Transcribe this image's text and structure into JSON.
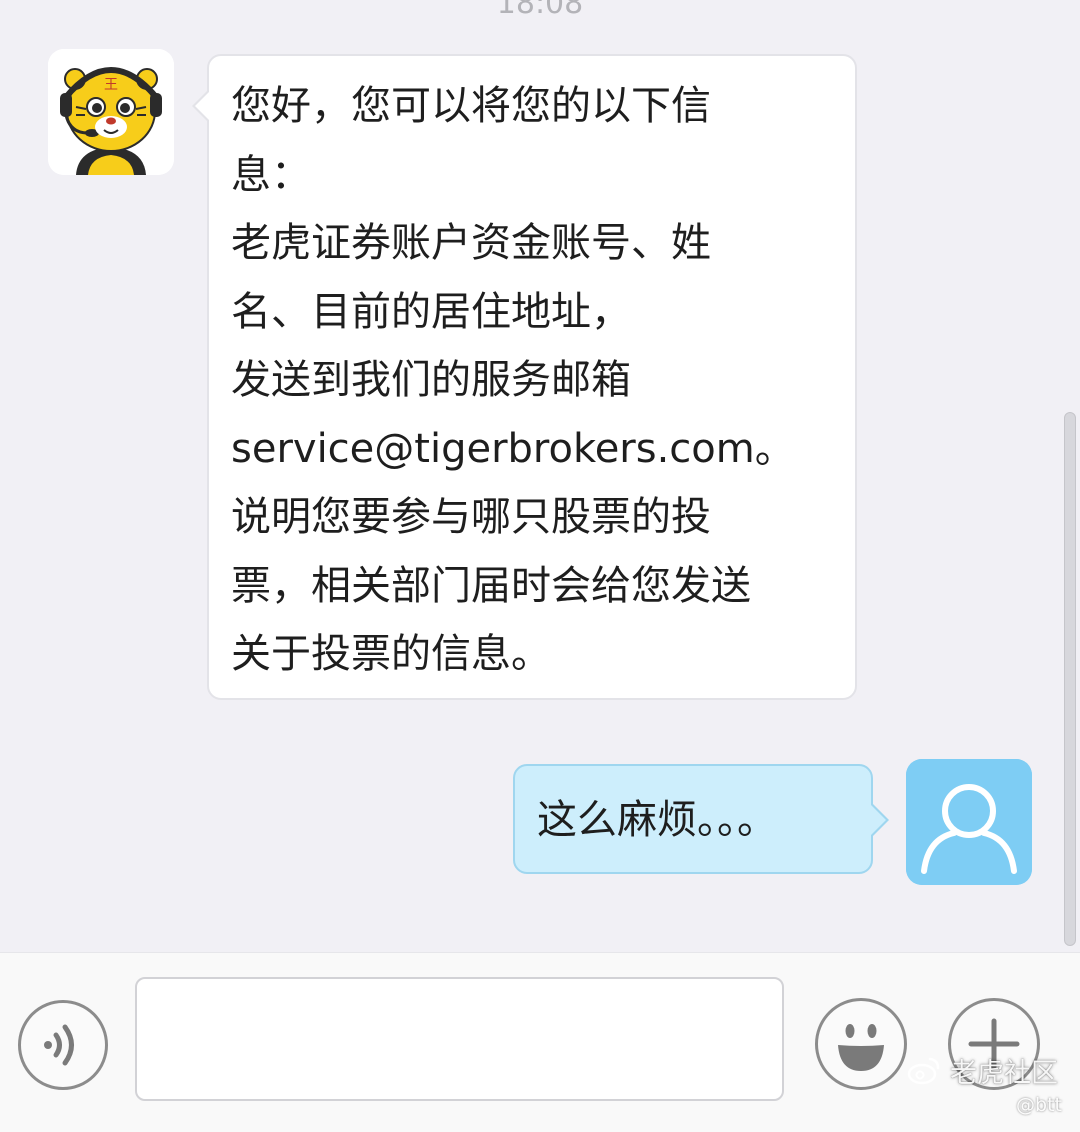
{
  "chat": {
    "timestamp": "18:08",
    "agent_message": {
      "lines": [
        "您好，您可以将您的以下信",
        "息：",
        "老虎证券账户资金账号、姓",
        "名、目前的居住地址，",
        "发送到我们的服务邮箱",
        "service@tigerbrokers.com。",
        "说明您要参与哪只股票的投",
        "票，相关部门届时会给您发送",
        "关于投票的信息。"
      ]
    },
    "user_message": {
      "text": "这么麻烦。。。"
    }
  },
  "input_bar": {
    "message_value": "",
    "message_placeholder": ""
  },
  "watermark": {
    "brand": "老虎社区",
    "handle": "@btt"
  },
  "icons": {
    "agent_avatar": "tiger-mascot-icon",
    "user_avatar": "default-user-icon",
    "voice": "voice-icon",
    "emoji": "emoji-icon",
    "plus": "plus-icon",
    "watermark": "weibo-logo-icon"
  },
  "colors": {
    "background": "#f1f0f5",
    "agent_bubble": "#ffffff",
    "user_bubble": "#cdeefc",
    "user_avatar_bg": "#7ecdf4",
    "mascot_yellow": "#f7cd1a"
  }
}
